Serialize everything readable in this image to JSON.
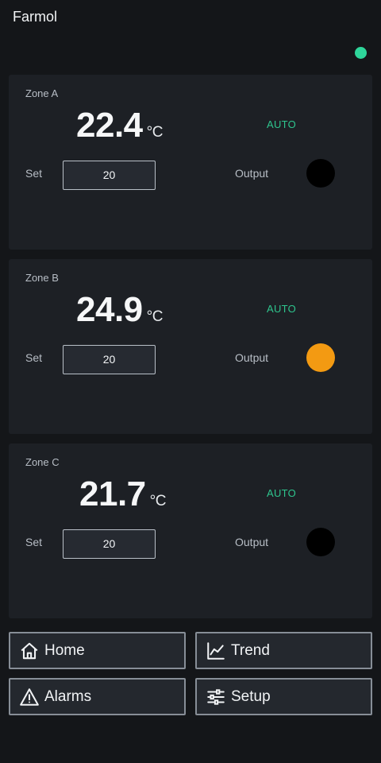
{
  "app": {
    "title": "Farmol"
  },
  "status": {
    "color": "#2ed59a"
  },
  "zones": [
    {
      "name": "Zone A",
      "temperature": "22.4",
      "unit": "°C",
      "mode": "AUTO",
      "set_label": "Set",
      "setpoint": "20",
      "output_label": "Output",
      "output_on": false,
      "output_color": "#000000"
    },
    {
      "name": "Zone B",
      "temperature": "24.9",
      "unit": "°C",
      "mode": "AUTO",
      "set_label": "Set",
      "setpoint": "20",
      "output_label": "Output",
      "output_on": true,
      "output_color": "#f39a12"
    },
    {
      "name": "Zone C",
      "temperature": "21.7",
      "unit": "°C",
      "mode": "AUTO",
      "set_label": "Set",
      "setpoint": "20",
      "output_label": "Output",
      "output_on": false,
      "output_color": "#000000"
    }
  ],
  "nav": {
    "home": {
      "label": "Home",
      "icon": "home-icon"
    },
    "trend": {
      "label": "Trend",
      "icon": "trend-icon"
    },
    "alarms": {
      "label": "Alarms",
      "icon": "warning-icon"
    },
    "setup": {
      "label": "Setup",
      "icon": "sliders-icon"
    }
  }
}
